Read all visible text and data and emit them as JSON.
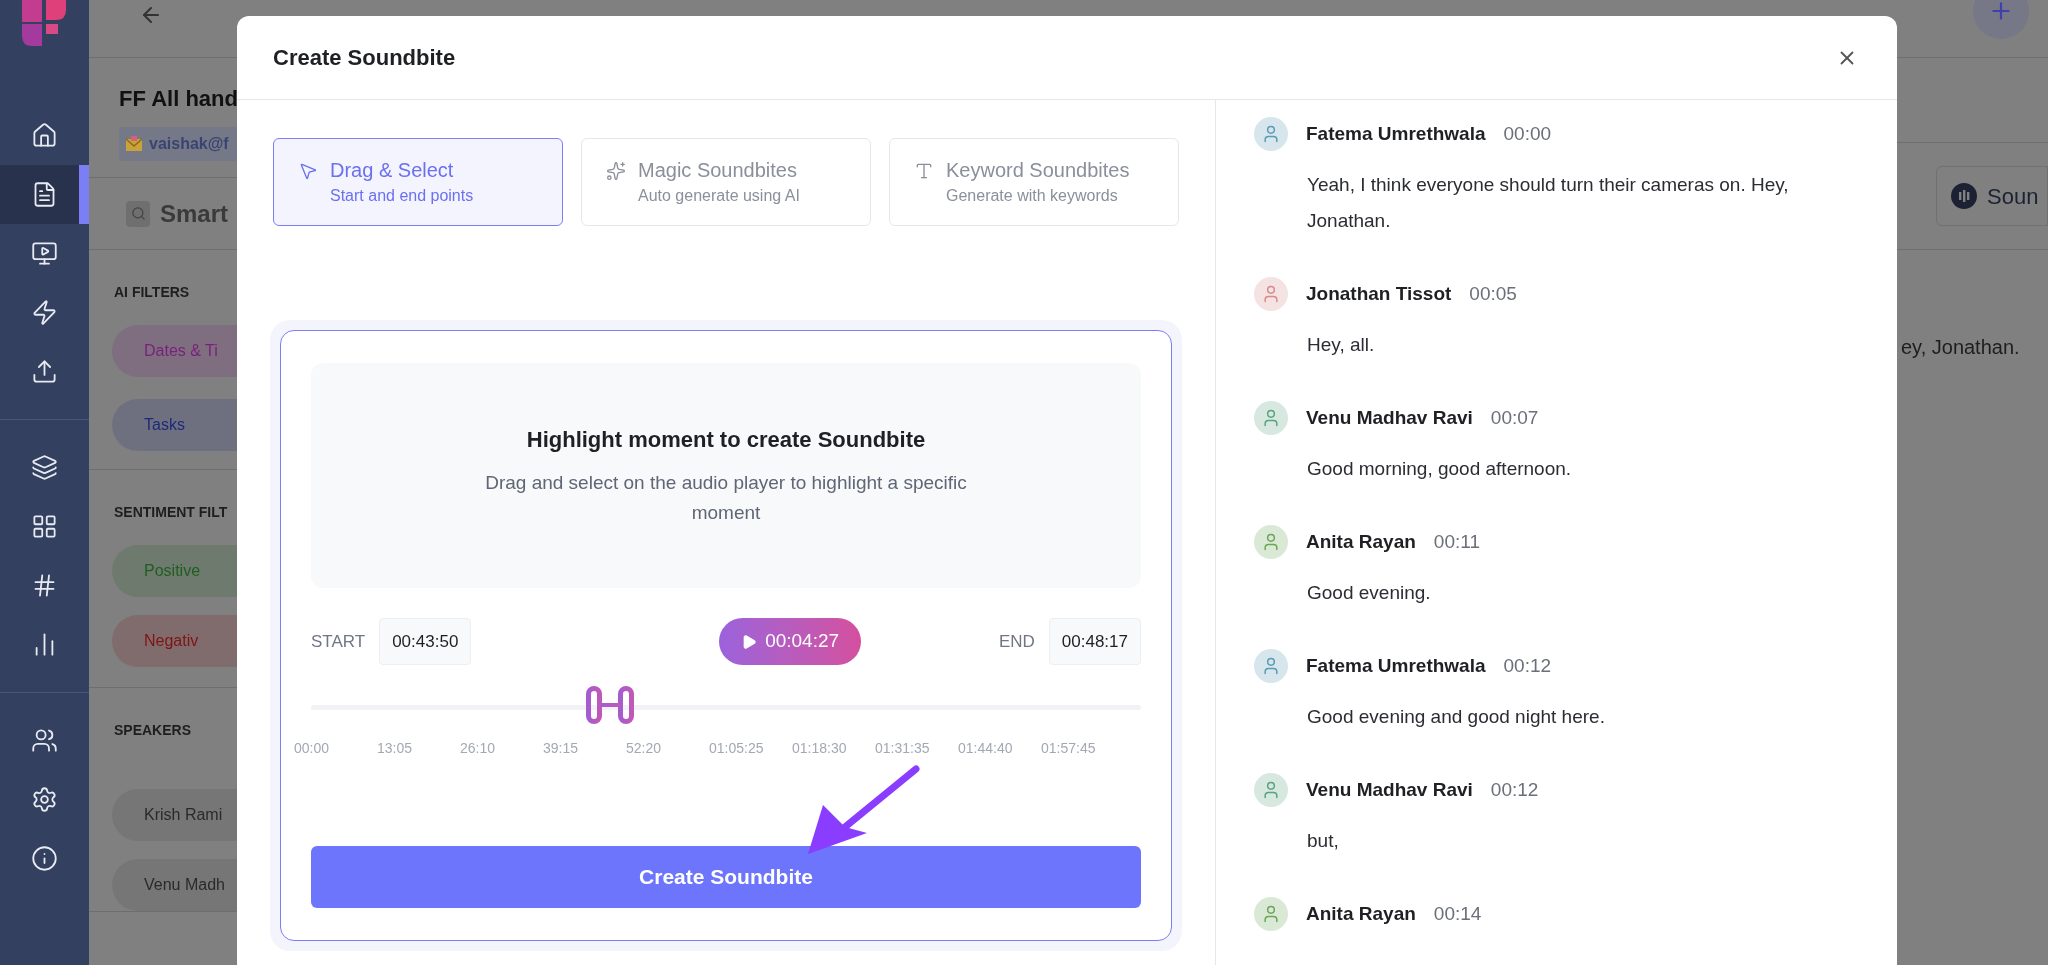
{
  "sidebar": {
    "groups": [
      [
        {
          "selected": false
        },
        {
          "selected": true
        },
        {
          "selected": false
        },
        {
          "selected": false
        },
        {
          "selected": false
        }
      ],
      [
        {
          "selected": false
        },
        {
          "selected": false
        },
        {
          "selected": false
        },
        {
          "selected": false
        }
      ],
      [
        {
          "selected": false
        },
        {
          "selected": false
        },
        {
          "selected": false
        }
      ]
    ]
  },
  "background": {
    "title": "FF All hand",
    "owner": "vaishak@f",
    "section": "Smart",
    "ai_filters": {
      "heading": "AI FILTERS",
      "chips": [
        {
          "label": "Dates & Ti",
          "color": "#7a1f7c"
        },
        {
          "label": "Tasks",
          "color": "#1e2a78"
        }
      ]
    },
    "sentiment_filters": {
      "heading": "SENTIMENT FILT",
      "chips": [
        {
          "label": "Positive",
          "color": "#1f5e1f"
        },
        {
          "label": "Negativ",
          "color": "#7f1414"
        }
      ]
    },
    "speakers": {
      "heading": "SPEAKERS",
      "chips": [
        {
          "label": "Krish Rami"
        },
        {
          "label": "Venu Madh"
        }
      ]
    },
    "soundbites_button": "Soun",
    "transcript_excerpt": "ey, Jonathan."
  },
  "modal": {
    "title": "Create Soundbite",
    "tabs": [
      {
        "title": "Drag & Select",
        "subtitle": "Start and end points",
        "selected": true
      },
      {
        "title": "Magic Soundbites",
        "subtitle": "Auto generate using AI",
        "selected": false
      },
      {
        "title": "Keyword Soundbites",
        "subtitle": "Generate with keywords",
        "selected": false
      }
    ],
    "player": {
      "heading": "Highlight moment to create Soundbite",
      "description": "Drag and select on the audio player to highlight a specific moment",
      "start_label": "START",
      "start": "00:43:50",
      "duration": "00:04:27",
      "end_label": "END",
      "end": "00:48:17",
      "handle": {
        "level": 0.36
      },
      "ticks": [
        "00:00",
        "13:05",
        "26:10",
        "39:15",
        "52:20",
        "01:05:25",
        "01:18:30",
        "01:31:35",
        "01:44:40",
        "01:57:45"
      ]
    },
    "create_button": "Create Soundbite",
    "transcript": [
      {
        "speaker": "Fatema Umrethwala",
        "time": "00:00",
        "color": "#5b9bb5",
        "text": "Yeah, I think everyone should turn their cameras on. Hey, Jonathan."
      },
      {
        "speaker": "Jonathan Tissot",
        "time": "00:05",
        "color": "#d98a8a",
        "text": "Hey, all."
      },
      {
        "speaker": "Venu Madhav Ravi",
        "time": "00:07",
        "color": "#5aa37e",
        "text": "Good morning, good afternoon."
      },
      {
        "speaker": "Anita Rayan",
        "time": "00:11",
        "color": "#6aa656",
        "text": "Good evening."
      },
      {
        "speaker": "Fatema Umrethwala",
        "time": "00:12",
        "color": "#5b9bb5",
        "text": "Good evening and good night here."
      },
      {
        "speaker": "Venu Madhav Ravi",
        "time": "00:12",
        "color": "#5aa37e",
        "text": "but,"
      },
      {
        "speaker": "Anita Rayan",
        "time": "00:14",
        "color": "#6aa656"
      }
    ]
  }
}
